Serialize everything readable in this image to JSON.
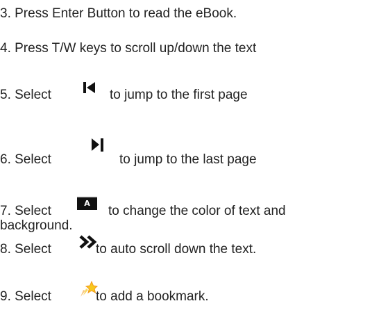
{
  "instructions": {
    "step3": "3. Press Enter Button to read the eBook.",
    "step4": "4. Press T/W keys to scroll up/down the text",
    "step5": {
      "prefix": "5. Select",
      "suffix": "to jump to the first page",
      "icon": "skip-to-first-icon"
    },
    "step6": {
      "prefix": "6. Select",
      "suffix": "to jump to the last page",
      "icon": "skip-to-last-icon"
    },
    "step7": {
      "prefix": "7. Select",
      "suffix": "to change the color of text and",
      "continuation": "background.",
      "icon": "text-color-icon",
      "icon_letter": "A"
    },
    "step8": {
      "prefix": "8. Select",
      "suffix": "to auto scroll down the text.",
      "icon": "auto-scroll-icon"
    },
    "step9": {
      "prefix": "9. Select",
      "suffix": "to add a bookmark.",
      "icon": "bookmark-star-icon"
    }
  },
  "colors": {
    "text": "#222222",
    "icon_dark": "#111111",
    "star_yellow": "#f7c81e",
    "star_orange": "#f39a1c"
  }
}
